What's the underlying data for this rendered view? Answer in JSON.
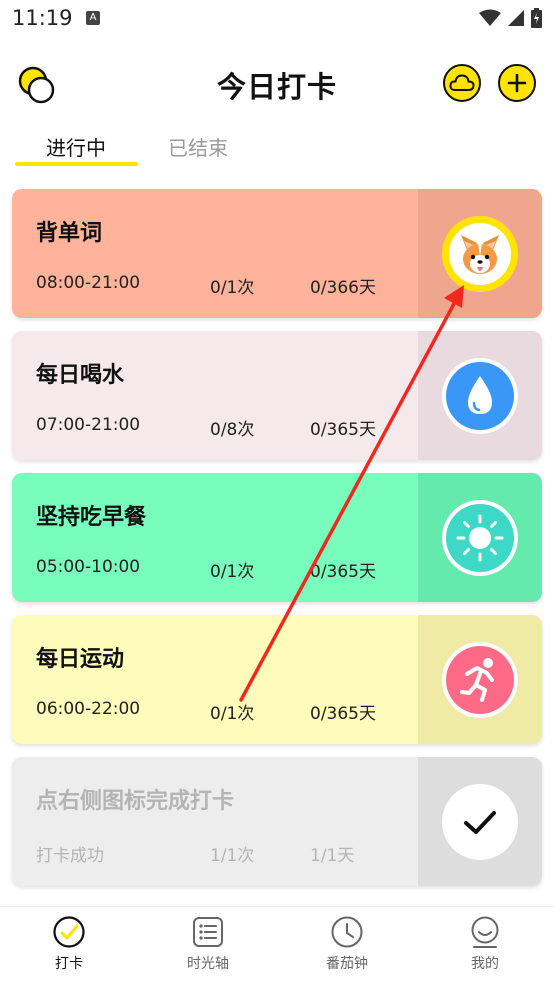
{
  "status_bar": {
    "time": "11:19",
    "notification_badge": "A"
  },
  "header": {
    "title": "今日打卡",
    "left_icon": "theme-toggle-icon",
    "right_icons": [
      "cloud-icon",
      "plus-icon"
    ]
  },
  "tabs": [
    {
      "label": "进行中",
      "active": true
    },
    {
      "label": "已结束",
      "active": false
    }
  ],
  "cards": [
    {
      "title": "背单词",
      "time": "08:00-21:00",
      "count": "0/1次",
      "days": "0/366天",
      "bg": "#ffb39a",
      "side_bg": "#f0a68e",
      "icon": "corgi-icon"
    },
    {
      "title": "每日喝水",
      "time": "07:00-21:00",
      "count": "0/8次",
      "days": "0/365天",
      "bg": "#f6e9ec",
      "side_bg": "#e9dadf",
      "icon": "water-drop-icon"
    },
    {
      "title": "坚持吃早餐",
      "time": "05:00-10:00",
      "count": "0/1次",
      "days": "0/365天",
      "bg": "#79fdbd",
      "side_bg": "#63eaac",
      "icon": "sun-icon"
    },
    {
      "title": "每日运动",
      "time": "06:00-22:00",
      "count": "0/1次",
      "days": "0/365天",
      "bg": "#fdfcba",
      "side_bg": "#efeaa6",
      "icon": "running-icon"
    },
    {
      "title": "点右侧图标完成打卡",
      "time": "打卡成功",
      "count": "1/1次",
      "days": "1/1天",
      "bg": "#ededed",
      "side_bg": "#dddddd",
      "icon": "checkmark-icon"
    }
  ],
  "bottom_nav": [
    {
      "label": "打卡",
      "icon": "checkin-icon",
      "active": true
    },
    {
      "label": "时光轴",
      "icon": "timeline-icon",
      "active": false
    },
    {
      "label": "番茄钟",
      "icon": "clock-icon",
      "active": false
    },
    {
      "label": "我的",
      "icon": "profile-icon",
      "active": false
    }
  ],
  "colors": {
    "accent": "#ffe400",
    "arrow": "#f0281e",
    "water_icon": "#3a96f7",
    "sun_icon": "#3ed8c7",
    "run_icon": "#ff6a86"
  }
}
